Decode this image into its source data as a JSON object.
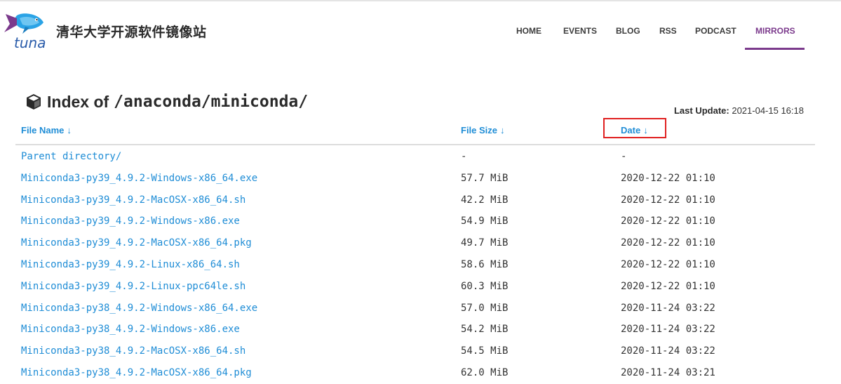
{
  "site": {
    "logo_text": "tuna",
    "title": "清华大学开源软件镜像站"
  },
  "nav": {
    "items": [
      {
        "label": "HOME"
      },
      {
        "label": "EVENTS"
      },
      {
        "label": "BLOG"
      },
      {
        "label": "RSS"
      },
      {
        "label": "PODCAST"
      },
      {
        "label": "MIRRORS",
        "active": true
      }
    ]
  },
  "page": {
    "heading_prefix": "Index of",
    "heading_path": "/anaconda/miniconda/",
    "last_update_label": "Last Update:",
    "last_update_value": "2021-04-15 16:18"
  },
  "table": {
    "columns": [
      {
        "label": "File Name",
        "arrow": "↓"
      },
      {
        "label": "File Size",
        "arrow": "↓"
      },
      {
        "label": "Date",
        "arrow": "↓"
      }
    ],
    "rows": [
      {
        "name": "Parent directory/",
        "size": "-",
        "date": "-"
      },
      {
        "name": "Miniconda3-py39_4.9.2-Windows-x86_64.exe",
        "size": "57.7 MiB",
        "date": "2020-12-22 01:10"
      },
      {
        "name": "Miniconda3-py39_4.9.2-MacOSX-x86_64.sh",
        "size": "42.2 MiB",
        "date": "2020-12-22 01:10"
      },
      {
        "name": "Miniconda3-py39_4.9.2-Windows-x86.exe",
        "size": "54.9 MiB",
        "date": "2020-12-22 01:10"
      },
      {
        "name": "Miniconda3-py39_4.9.2-MacOSX-x86_64.pkg",
        "size": "49.7 MiB",
        "date": "2020-12-22 01:10"
      },
      {
        "name": "Miniconda3-py39_4.9.2-Linux-x86_64.sh",
        "size": "58.6 MiB",
        "date": "2020-12-22 01:10"
      },
      {
        "name": "Miniconda3-py39_4.9.2-Linux-ppc64le.sh",
        "size": "60.3 MiB",
        "date": "2020-12-22 01:10"
      },
      {
        "name": "Miniconda3-py38_4.9.2-Windows-x86_64.exe",
        "size": "57.0 MiB",
        "date": "2020-11-24 03:22"
      },
      {
        "name": "Miniconda3-py38_4.9.2-Windows-x86.exe",
        "size": "54.2 MiB",
        "date": "2020-11-24 03:22"
      },
      {
        "name": "Miniconda3-py38_4.9.2-MacOSX-x86_64.sh",
        "size": "54.5 MiB",
        "date": "2020-11-24 03:22"
      },
      {
        "name": "Miniconda3-py38_4.9.2-MacOSX-x86_64.pkg",
        "size": "62.0 MiB",
        "date": "2020-11-24 03:21"
      }
    ]
  },
  "colors": {
    "link": "#1f8dd6",
    "accent": "#7b3a8c",
    "highlight": "#e02020"
  }
}
